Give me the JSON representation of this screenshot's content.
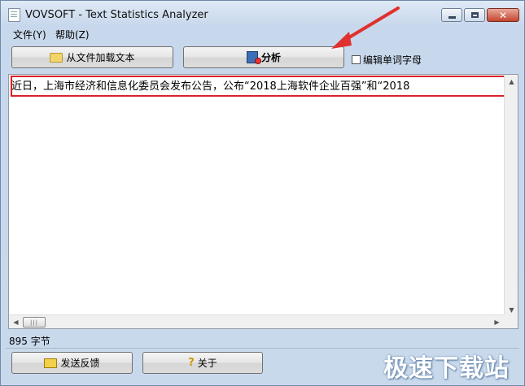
{
  "window": {
    "title": "VOVSOFT - Text Statistics Analyzer",
    "close_glyph": "✕"
  },
  "menu": {
    "items": [
      {
        "label": "文件(Y)"
      },
      {
        "label": "帮助(Z)"
      }
    ]
  },
  "toolbar": {
    "load_label": "从文件加载文本",
    "analyze_label": "分析",
    "edit_checkbox_label": "编辑单词字母",
    "edit_checked": false
  },
  "editor": {
    "text": "近日，上海市经济和信息化委员会发布公告，公布“2018上海软件企业百强”和“2018",
    "highlight_color": "#d9232a"
  },
  "scroll": {
    "up": "▲",
    "down": "▼",
    "left": "◀",
    "right": "▶",
    "thumb_grip": "|||"
  },
  "status": {
    "byte_count": "895 字节"
  },
  "footer": {
    "feedback_label": "发送反馈",
    "about_label": "关于",
    "about_icon": "?"
  },
  "watermark": {
    "text": "极速下载站"
  },
  "colors": {
    "annotation_red": "#d9232a",
    "window_bg": "#c9d9ec"
  }
}
